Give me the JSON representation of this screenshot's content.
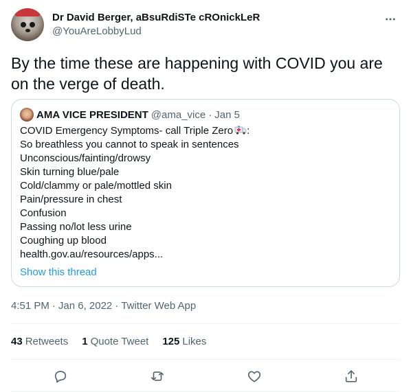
{
  "author": {
    "display_name": "Dr David Berger, aBsuRdiSTe cROnickLeR",
    "handle": "@YouAreLobbyLud"
  },
  "tweet_text": "By the time these are happening with COVID you are on the verge of death.",
  "quoted_tweet": {
    "name": "AMA VICE PRESIDENT",
    "handle": "@ama_vice",
    "dot": "·",
    "date": "Jan 5",
    "lines": [
      "COVID Emergency Symptoms- call Triple Zero",
      "So breathless you cannot to speak in sentences",
      "Unconscious/fainting/drowsy",
      "Skin turning blue/pale",
      "Cold/clammy or pale/mottled skin",
      "Pain/pressure in chest",
      "Confusion",
      "Passing no/lot less urine",
      "Coughing up blood",
      "health.gov.au/resources/apps..."
    ],
    "first_line_suffix": ":",
    "show_thread": "Show this thread"
  },
  "meta": {
    "time": "4:51 PM",
    "sep1": "·",
    "date": "Jan 6, 2022",
    "sep2": "·",
    "source": "Twitter Web App"
  },
  "stats": {
    "retweets_count": "43",
    "retweets_label": "Retweets",
    "quotes_count": "1",
    "quotes_label": "Quote Tweet",
    "likes_count": "125",
    "likes_label": "Likes"
  },
  "icons": {
    "more": "more-horizontal-icon",
    "reply": "reply-icon",
    "retweet": "retweet-icon",
    "like": "heart-icon",
    "share": "share-icon",
    "emoji": "ambulance-icon"
  },
  "colors": {
    "link": "#1d9bf0",
    "secondary_text": "#536471",
    "border": "#cfd9de"
  }
}
